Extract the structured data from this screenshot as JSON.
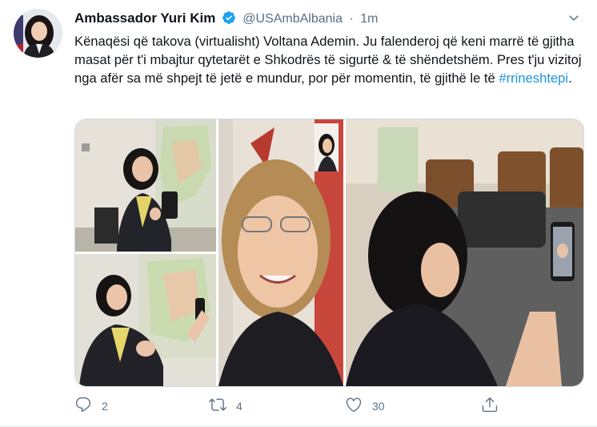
{
  "tweet": {
    "author_name": "Ambassador Yuri Kim",
    "handle": "@USAmbAlbania",
    "separator": "·",
    "time": "1m",
    "text_main": "Kënaqësi që takova (virtualisht) Voltana Ademin. Ju falenderoj që keni marrë të gjitha masat për t'i mbajtur qytetarët e Shkodrës të sigurtë & të shëndetshëm. Pres t'ju vizitoj nga afër sa më shpejt të jetë e mundur, por për momentin, të gjithë le të ",
    "hashtag": "#rrineshtepi",
    "text_end": "."
  },
  "actions": {
    "reply_count": "2",
    "retweet_count": "4",
    "like_count": "30"
  },
  "icons": {
    "verified": "verified-badge-icon",
    "caret": "chevron-down-icon",
    "reply": "reply-icon",
    "retweet": "retweet-icon",
    "like": "heart-icon",
    "share": "share-icon"
  },
  "colors": {
    "accent": "#1b95e0",
    "secondary_text": "#5b7083",
    "verified": "#1da1f2"
  }
}
